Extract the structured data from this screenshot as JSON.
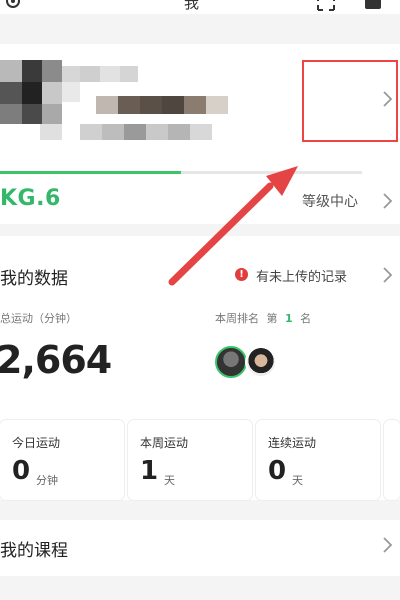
{
  "header": {
    "title": "我"
  },
  "profile": {
    "level": "KG.6",
    "level_center": "等级中心",
    "level_progress": 0.5
  },
  "data_section": {
    "title": "我的数据",
    "warning": "有未上传的记录",
    "total_label": "总运动（分钟）",
    "total_value": "2,664",
    "rank_label_prefix": "本周排名",
    "rank_di": "第",
    "rank_value": "1",
    "rank_unit": "名"
  },
  "stats": [
    {
      "label": "今日运动",
      "value": "0",
      "unit": "分钟"
    },
    {
      "label": "本周运动",
      "value": "1",
      "unit": "天"
    },
    {
      "label": "连续运动",
      "value": "0",
      "unit": "天"
    }
  ],
  "courses": {
    "title": "我的课程"
  },
  "colors": {
    "accent": "#33b86a",
    "warning": "#e23d3d",
    "annotation": "#e44444"
  }
}
